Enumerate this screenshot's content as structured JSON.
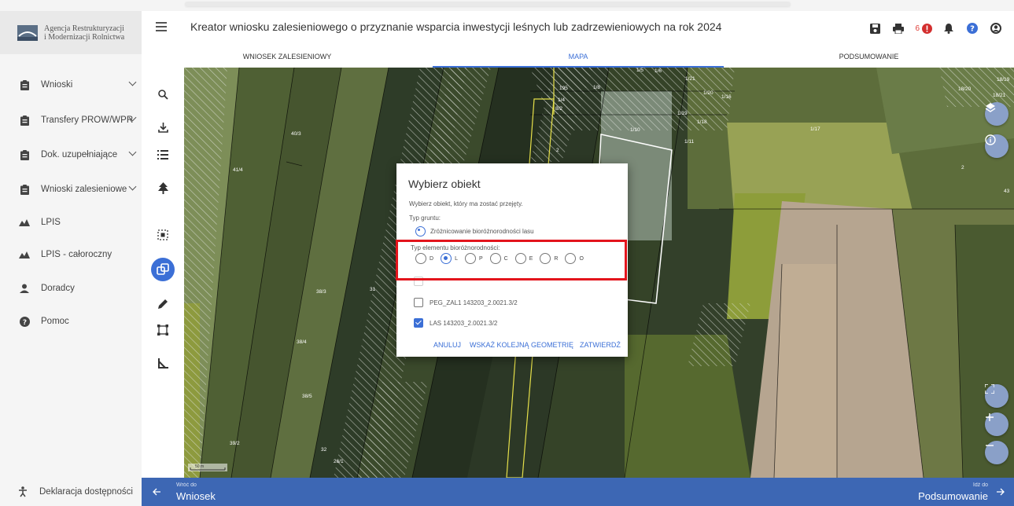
{
  "logo": {
    "line1": "Agencja Restrukturyzacji",
    "line2": "i Modernizacji Rolnictwa"
  },
  "header": {
    "title": "Kreator wniosku zalesieniowego o przyznanie wsparcia inwestycji leśnych lub zadrzewieniowych na rok 2024",
    "notification_count": "6"
  },
  "tabs": [
    {
      "label": "WNIOSEK ZALESIENIOWY",
      "active": false
    },
    {
      "label": "MAPA",
      "active": true
    },
    {
      "label": "PODSUMOWANIE",
      "active": false
    }
  ],
  "sidebar": {
    "items": [
      {
        "label": "Wnioski",
        "icon": "clipboard-icon",
        "expandable": true
      },
      {
        "label": "Transfery PROW/WPR",
        "icon": "clipboard-icon",
        "expandable": true
      },
      {
        "label": "Dok. uzupełniające",
        "icon": "clipboard-icon",
        "expandable": true
      },
      {
        "label": "Wnioski zalesieniowe",
        "icon": "clipboard-icon",
        "expandable": true
      },
      {
        "label": "LPIS",
        "icon": "mountains-icon",
        "expandable": false
      },
      {
        "label": "LPIS - całoroczny",
        "icon": "mountains-icon",
        "expandable": false
      },
      {
        "label": "Doradcy",
        "icon": "person-icon",
        "expandable": false
      },
      {
        "label": "Pomoc",
        "icon": "help-icon",
        "expandable": false
      }
    ],
    "accessibility": "Deklaracja dostępności"
  },
  "map": {
    "parcel_labels": [
      "195",
      "1/4",
      "1/8",
      "1/21",
      "1/20",
      "1/16",
      "8/2",
      "1/19",
      "1/10",
      "1/18",
      "1/11",
      "1/17",
      "18/19",
      "18/20",
      "18/21",
      "2",
      "43",
      "40/3",
      "41/4",
      "2",
      "38/3",
      "31",
      "38/4",
      "38/5",
      "39/2",
      "32",
      "26/1",
      "1/5",
      "1/6"
    ],
    "scale": "50 m"
  },
  "dialog": {
    "title": "Wybierz obiekt",
    "subtitle": "Wybierz obiekt, który ma zostać przejęty.",
    "ground_type_label": "Typ gruntu:",
    "ground_type_option": "Zróżnicowanie bioróżnorodności lasu",
    "biodiversity_label": "Typ elementu bioróżnorodności:",
    "biodiversity_options": [
      "D",
      "L",
      "P",
      "C",
      "E",
      "R",
      "O"
    ],
    "biodiversity_selected": "L",
    "objects": [
      {
        "label": "PEG_ZAL1 143203_2.0021.3/2",
        "checked": false
      },
      {
        "label": "LAS 143203_2.0021.3/2",
        "checked": true
      }
    ],
    "buttons": {
      "cancel": "ANULUJ",
      "next": "WSKAŻ KOLEJNĄ GEOMETRIĘ",
      "confirm": "ZATWIERDŹ"
    }
  },
  "footer": {
    "back_small": "Wróć do",
    "back_label": "Wniosek",
    "next_small": "Idź do",
    "next_label": "Podsumowanie"
  },
  "colors": {
    "accent": "#3b6fd6",
    "footer": "#3d67b4",
    "highlight": "#e3141c"
  }
}
